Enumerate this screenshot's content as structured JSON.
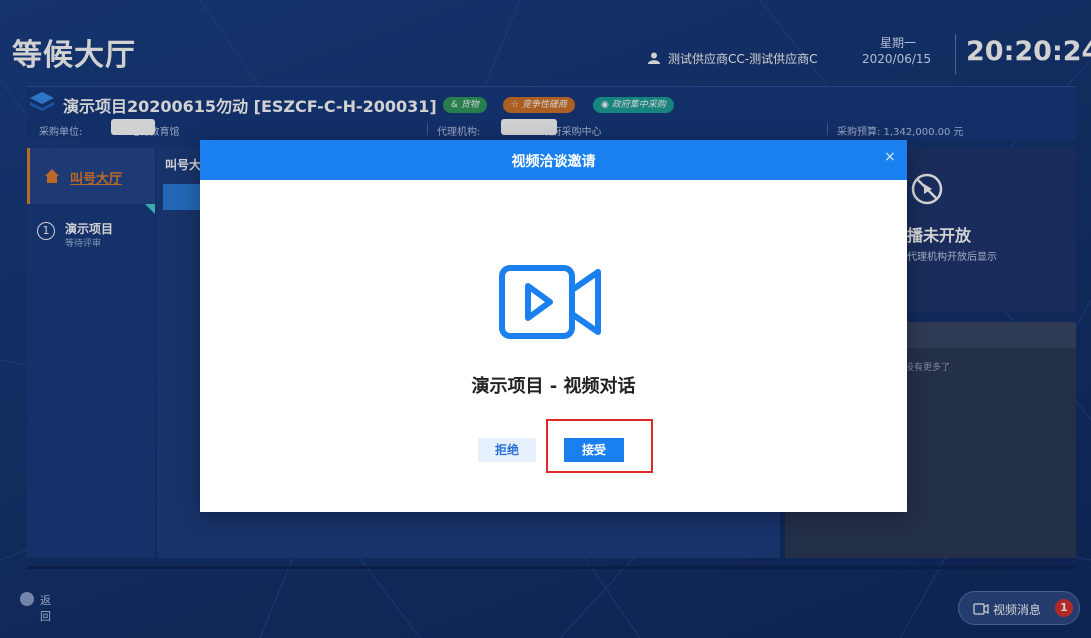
{
  "header": {
    "title": "等候大厅",
    "user_name": "测试供应商CC-测试供应商C",
    "weekday": "星期一",
    "date": "2020/06/15",
    "time": "20:20:24"
  },
  "project": {
    "title": "演示项目20200615勿动 [ESZCF-C-H-200031]",
    "tags": [
      "货物",
      "竞争性磋商",
      "政府集中采购"
    ],
    "unit_label": "采购单位: ",
    "unit_value": "电化教育馆",
    "agent_label": "代理机构: ",
    "agent_value": "政府采购中心",
    "budget": "采购预算: 1,342,000.00 元"
  },
  "sidebar": {
    "active_item": "叫号大厅",
    "project_number": "1",
    "project_name": "演示项目",
    "project_status": "等待评审"
  },
  "middle": {
    "title": "叫号大"
  },
  "right": {
    "live_title": "播未开放",
    "live_subtitle": "代理机构开放后显示",
    "no_more": "没有更多了"
  },
  "footer": {
    "back_label": "返回",
    "video_msg_label": "视频消息",
    "video_msg_count": "1"
  },
  "modal": {
    "title": "视频洽谈邀请",
    "close": "×",
    "subject": "演示项目 - 视频对话",
    "reject_label": "拒绝",
    "accept_label": "接受"
  },
  "colors": {
    "primary": "#1a80f0",
    "accent_orange": "#e3802f",
    "highlight": "#e02a2a"
  }
}
